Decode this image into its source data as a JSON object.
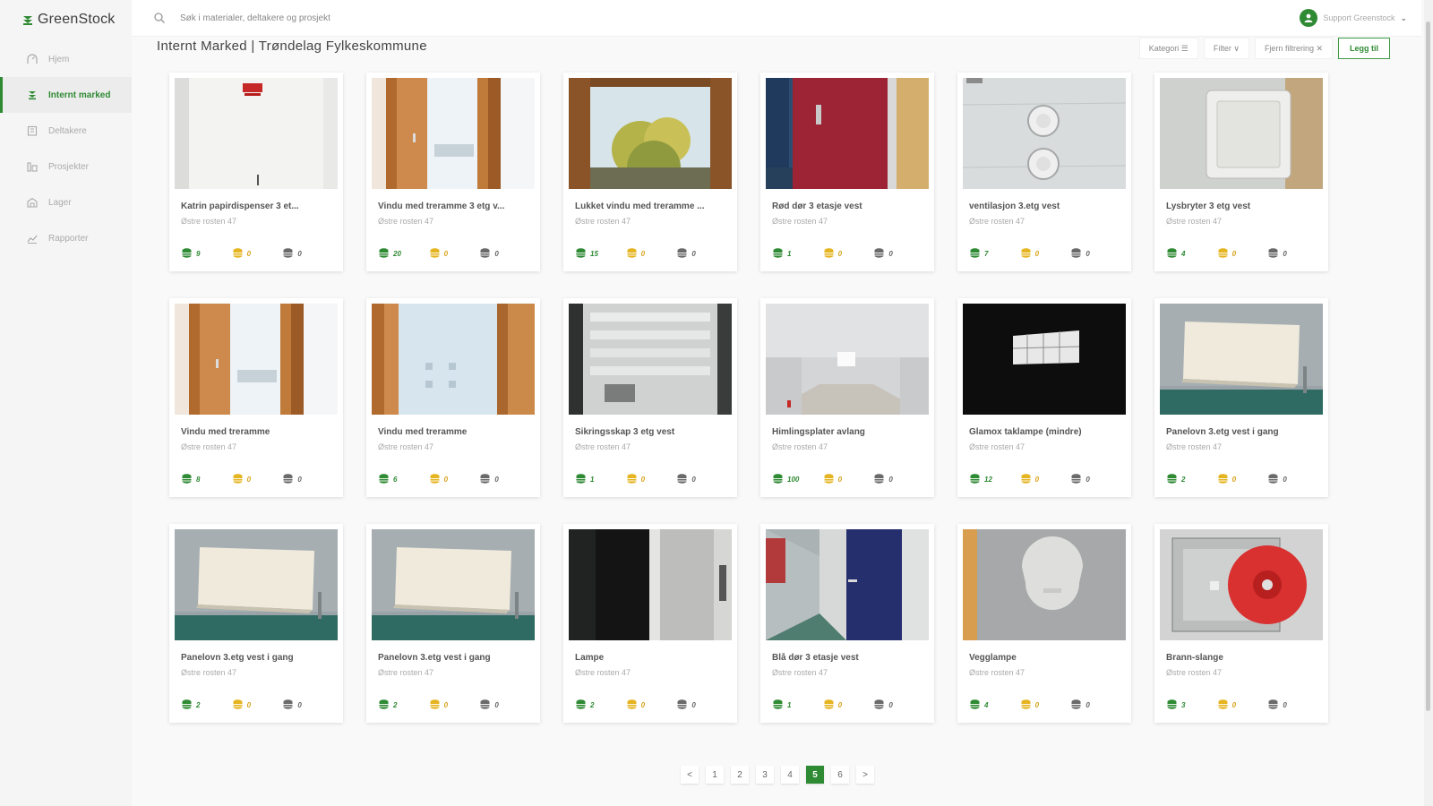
{
  "brand": {
    "name": "GreenStock"
  },
  "colors": {
    "accent": "#2f8a34",
    "coin_green": "#2f8a34",
    "coin_yellow": "#e5b421",
    "coin_gray": "#6a6a6a"
  },
  "sidebar": {
    "items": [
      {
        "label": "Hjem",
        "icon": "home-icon",
        "active": false
      },
      {
        "label": "Internt marked",
        "icon": "leaf-icon",
        "active": true
      },
      {
        "label": "Deltakere",
        "icon": "building-icon",
        "active": false
      },
      {
        "label": "Prosjekter",
        "icon": "projects-icon",
        "active": false
      },
      {
        "label": "Lager",
        "icon": "warehouse-icon",
        "active": false
      },
      {
        "label": "Rapporter",
        "icon": "chart-icon",
        "active": false
      }
    ]
  },
  "topbar": {
    "search_placeholder": "Søk i materialer, deltakere og prosjekt",
    "user_name": "Support Greenstock"
  },
  "header": {
    "title": "Internt Marked | Trøndelag Fylkeskommune",
    "kategori": "Kategori ☰",
    "filter": "Filter ∨",
    "clear": "Fjern filtrering ✕",
    "add": "Legg til"
  },
  "cards": [
    {
      "title": "Katrin papirdispenser 3 et...",
      "location": "Østre rosten 47",
      "green": "9",
      "yellow": "0",
      "gray": "0",
      "img": "dispenser"
    },
    {
      "title": "Vindu med treramme 3 etg v...",
      "location": "Østre rosten 47",
      "green": "20",
      "yellow": "0",
      "gray": "0",
      "img": "window"
    },
    {
      "title": "Lukket vindu med treramme ...",
      "location": "Østre rosten 47",
      "green": "15",
      "yellow": "0",
      "gray": "0",
      "img": "window-tree"
    },
    {
      "title": "Rød dør 3 etasje vest",
      "location": "Østre rosten 47",
      "green": "1",
      "yellow": "0",
      "gray": "0",
      "img": "red-door"
    },
    {
      "title": "ventilasjon 3.etg vest",
      "location": "Østre rosten 47",
      "green": "7",
      "yellow": "0",
      "gray": "0",
      "img": "vent"
    },
    {
      "title": "Lysbryter 3 etg vest",
      "location": "Østre rosten 47",
      "green": "4",
      "yellow": "0",
      "gray": "0",
      "img": "switch"
    },
    {
      "title": "Vindu med treramme",
      "location": "Østre rosten 47",
      "green": "8",
      "yellow": "0",
      "gray": "0",
      "img": "window"
    },
    {
      "title": "Vindu med treramme",
      "location": "Østre rosten 47",
      "green": "6",
      "yellow": "0",
      "gray": "0",
      "img": "window-blue"
    },
    {
      "title": "Sikringsskap 3 etg vest",
      "location": "Østre rosten 47",
      "green": "1",
      "yellow": "0",
      "gray": "0",
      "img": "fusebox"
    },
    {
      "title": "Himlingsplater avlang",
      "location": "Østre rosten 47",
      "green": "100",
      "yellow": "0",
      "gray": "0",
      "img": "ceiling"
    },
    {
      "title": "Glamox taklampe (mindre)",
      "location": "Østre rosten 47",
      "green": "12",
      "yellow": "0",
      "gray": "0",
      "img": "lamp-dark"
    },
    {
      "title": "Panelovn 3.etg vest i gang",
      "location": "Østre rosten 47",
      "green": "2",
      "yellow": "0",
      "gray": "0",
      "img": "radiator"
    },
    {
      "title": "Panelovn 3.etg vest i gang",
      "location": "Østre rosten 47",
      "green": "2",
      "yellow": "0",
      "gray": "0",
      "img": "radiator"
    },
    {
      "title": "Panelovn 3.etg vest i gang",
      "location": "Østre rosten 47",
      "green": "2",
      "yellow": "0",
      "gray": "0",
      "img": "radiator"
    },
    {
      "title": "Lampe",
      "location": "Østre rosten 47",
      "green": "2",
      "yellow": "0",
      "gray": "0",
      "img": "lampe"
    },
    {
      "title": "Blå dør 3 etasje vest",
      "location": "Østre rosten 47",
      "green": "1",
      "yellow": "0",
      "gray": "0",
      "img": "blue-door"
    },
    {
      "title": "Vegglampe",
      "location": "Østre rosten 47",
      "green": "4",
      "yellow": "0",
      "gray": "0",
      "img": "wall-lamp"
    },
    {
      "title": "Brann-slange",
      "location": "Østre rosten 47",
      "green": "3",
      "yellow": "0",
      "gray": "0",
      "img": "fire-hose"
    }
  ],
  "pagination": {
    "prev": "<",
    "next": ">",
    "pages": [
      "1",
      "2",
      "3",
      "4",
      "5",
      "6"
    ],
    "current": "5"
  }
}
